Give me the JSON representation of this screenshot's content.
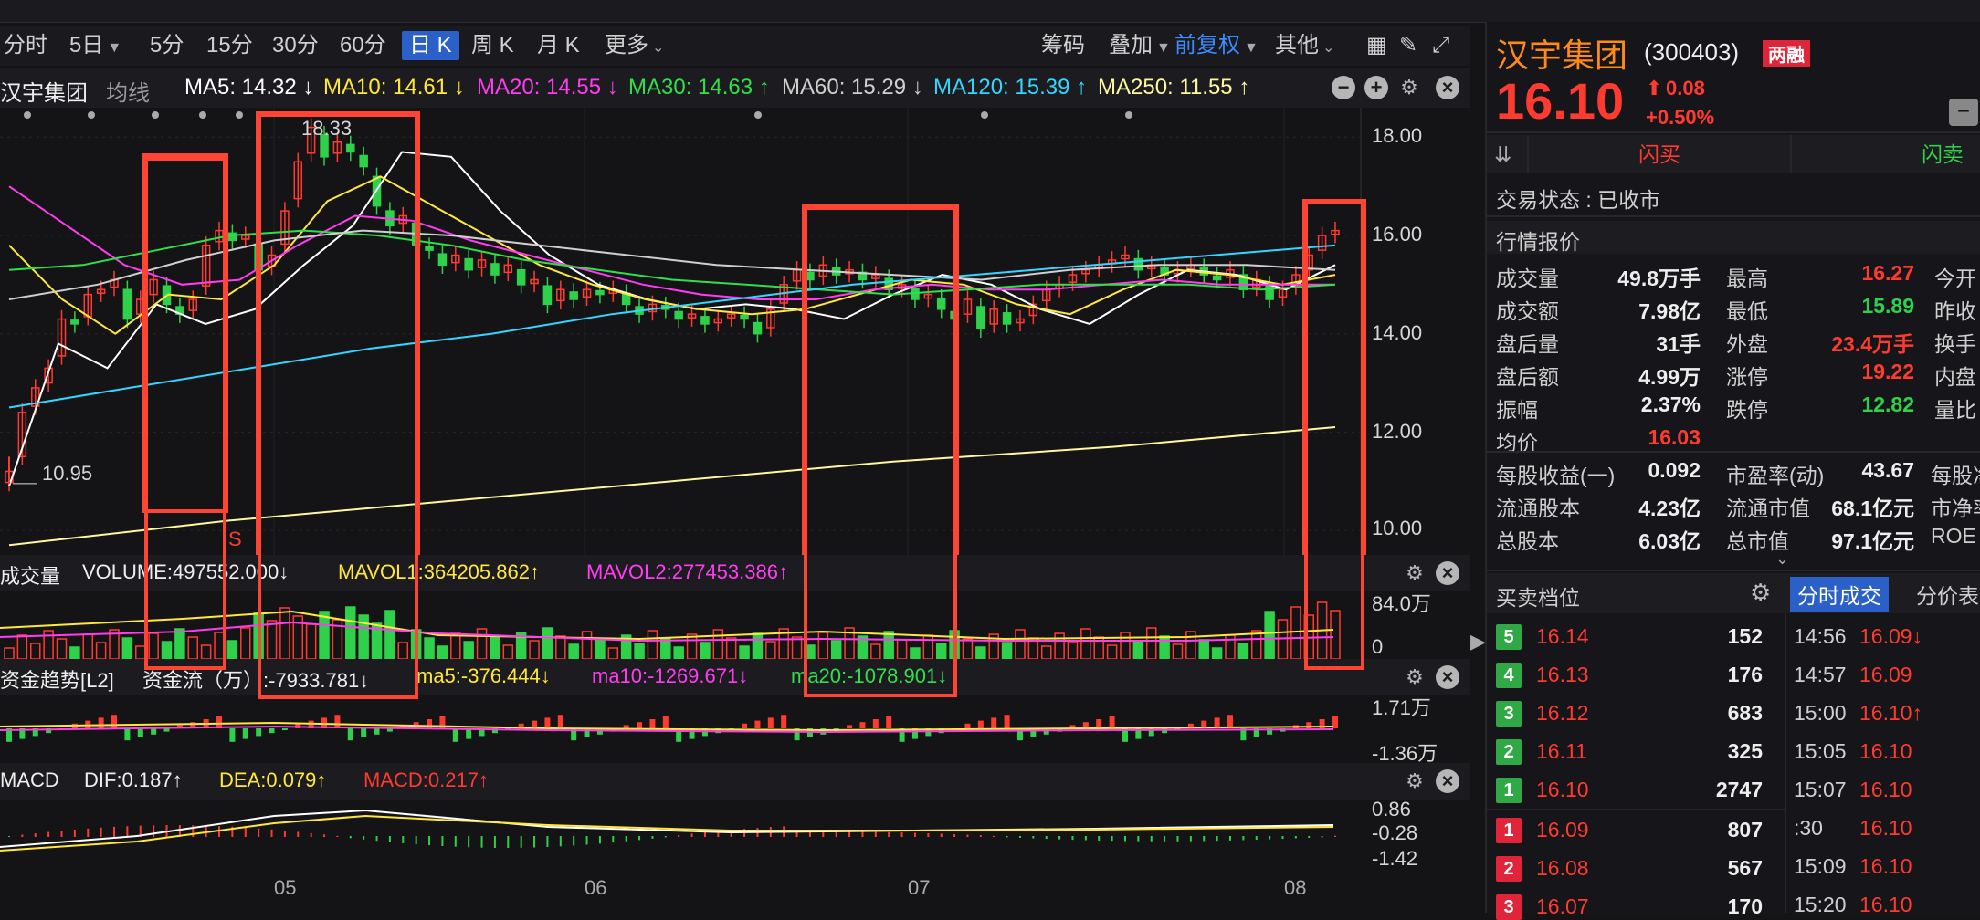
{
  "toolbar": {
    "periods": [
      "分时",
      "5日",
      "5分",
      "15分",
      "30分",
      "60分",
      "日 K",
      "周 K",
      "月 K",
      "更多"
    ],
    "active": "日 K",
    "right_items": [
      "筹码",
      "叠加",
      "前复权",
      "其他"
    ]
  },
  "stock": {
    "name": "汉宇集团",
    "code": "(300403)",
    "tag": "两融",
    "price": "16.10",
    "change": "0.08",
    "change_pct": "+0.50%"
  },
  "ma_line": {
    "mode": "均线",
    "items": [
      {
        "text": "MA5: 14.32 ↓",
        "color": "#ffffff"
      },
      {
        "text": "MA10: 14.61 ↓",
        "color": "#ffe83a"
      },
      {
        "text": "MA20: 14.55 ↓",
        "color": "#ff3cf0"
      },
      {
        "text": "MA30: 14.63 ↑",
        "color": "#2fe04a"
      },
      {
        "text": "MA60: 15.29 ↓",
        "color": "#cfcfcf"
      },
      {
        "text": "MA120: 15.39 ↑",
        "color": "#33d6ff"
      },
      {
        "text": "MA250: 11.55 ↑",
        "color": "#fff6a0"
      }
    ]
  },
  "price_axis": [
    "18.00",
    "16.00",
    "14.00",
    "12.00",
    "10.00"
  ],
  "annotations": {
    "high": "18.33",
    "low": "10.95",
    "marker": "S"
  },
  "volume": {
    "title": "成交量",
    "vol": "VOLUME:497552.000↓",
    "mavol1": "MAVOL1:364205.862↑",
    "mavol2": "MAVOL2:277453.386↑",
    "axis": [
      "84.0万",
      "0"
    ]
  },
  "fund": {
    "title": "资金趋势[L2]",
    "flow": "资金流（万）:-7933.781↓",
    "ma5": "ma5:-376.444↓",
    "ma10": "ma10:-1269.671↓",
    "ma20": "ma20:-1078.901↓",
    "axis": [
      "1.71万",
      "-1.36万"
    ]
  },
  "macd": {
    "title": "MACD",
    "dif": "DIF:0.187↑",
    "dea": "DEA:0.079↑",
    "macd": "MACD:0.217↑",
    "axis": [
      "0.86",
      "-0.28",
      "-1.42"
    ]
  },
  "months": [
    "05",
    "06",
    "07",
    "08"
  ],
  "right_panel": {
    "buy": "闪买",
    "sell": "闪卖",
    "status": "交易状态 : 已收市",
    "quote_title": "行情报价",
    "quotes": [
      [
        "成交量",
        "49.8万手",
        "最高",
        "16.27",
        "今开"
      ],
      [
        "成交额",
        "7.98亿",
        "最低",
        "15.89",
        "昨收"
      ],
      [
        "盘后量",
        "31手",
        "外盘",
        "23.4万手",
        "换手"
      ],
      [
        "盘后额",
        "4.99万",
        "涨停",
        "19.22",
        "内盘"
      ],
      [
        "振幅",
        "2.37%",
        "跌停",
        "12.82",
        "量比"
      ],
      [
        "均价",
        "16.03",
        "",
        "",
        ""
      ]
    ],
    "fundamentals": [
      [
        "每股收益(一)",
        "0.092",
        "市盈率(动)",
        "43.67",
        "每股净资"
      ],
      [
        "流通股本",
        "4.23亿",
        "流通市值",
        "68.1亿元",
        "市净率"
      ],
      [
        "总股本",
        "6.03亿",
        "总市值",
        "97.1亿元",
        "ROE"
      ]
    ],
    "orderbook_title": "买卖档位",
    "tab_active": "分时成交",
    "tab_other": "分价表",
    "asks": [
      {
        "lvl": "5",
        "price": "16.14",
        "vol": "152"
      },
      {
        "lvl": "4",
        "price": "16.13",
        "vol": "176"
      },
      {
        "lvl": "3",
        "price": "16.12",
        "vol": "683"
      },
      {
        "lvl": "2",
        "price": "16.11",
        "vol": "325"
      },
      {
        "lvl": "1",
        "price": "16.10",
        "vol": "2747"
      }
    ],
    "bids": [
      {
        "lvl": "1",
        "price": "16.09",
        "vol": "807"
      },
      {
        "lvl": "2",
        "price": "16.08",
        "vol": "567"
      },
      {
        "lvl": "3",
        "price": "16.07",
        "vol": "170"
      }
    ],
    "ticks": [
      {
        "time": "14:56",
        "price": "16.09↓"
      },
      {
        "time": "14:57",
        "price": "16.09"
      },
      {
        "time": "15:00",
        "price": "16.10↑"
      },
      {
        "time": "15:05",
        "price": "16.10"
      },
      {
        "time": "15:07",
        "price": "16.10"
      },
      {
        "time": ":30",
        "price": "16.10"
      },
      {
        "time": "15:09",
        "price": "16.10"
      },
      {
        "time": "15:20",
        "price": "16.10"
      }
    ]
  },
  "colors": {
    "up": "#ff3b30",
    "down": "#2fd14a",
    "highlight": "#ff4433",
    "accent": "#2b60c8"
  },
  "chart_data": {
    "type": "candlestick",
    "title": "",
    "ylim": [
      9.5,
      18.6
    ],
    "y_ticks": [
      10,
      12,
      14,
      16,
      18
    ],
    "x_ticks": [
      "05",
      "06",
      "07",
      "08"
    ],
    "closes": [
      11.2,
      12.4,
      12.9,
      13.3,
      14.3,
      14.2,
      14.8,
      14.9,
      15.1,
      14.3,
      14.7,
      15.1,
      14.6,
      14.4,
      14.7,
      15.8,
      16.1,
      15.9,
      16.0,
      15.3,
      15.6,
      16.5,
      17.5,
      18.2,
      17.6,
      17.9,
      17.7,
      17.4,
      16.6,
      16.2,
      16.4,
      15.8,
      15.7,
      15.4,
      15.6,
      15.3,
      15.5,
      15.2,
      15.4,
      15.0,
      15.1,
      14.6,
      14.9,
      14.7,
      14.9,
      14.8,
      14.9,
      14.6,
      14.4,
      14.6,
      14.5,
      14.3,
      14.4,
      14.2,
      14.3,
      14.4,
      14.3,
      14.0,
      14.5,
      15.0,
      15.3,
      15.1,
      15.4,
      15.2,
      15.3,
      15.1,
      15.2,
      14.9,
      15.0,
      14.7,
      14.8,
      14.5,
      14.3,
      14.7,
      14.1,
      14.5,
      14.2,
      14.3,
      14.6,
      14.9,
      15.0,
      15.2,
      15.3,
      15.4,
      15.5,
      15.6,
      15.3,
      15.4,
      15.2,
      15.3,
      15.4,
      15.2,
      15.1,
      15.3,
      14.9,
      15.1,
      14.7,
      14.9,
      15.2,
      15.6,
      16.0,
      16.1
    ],
    "series": [
      {
        "name": "MA5",
        "color": "#ffffff",
        "values": [
          10.9,
          13.8,
          13.3,
          14.6,
          14.2,
          14.5,
          15.4,
          16.2,
          17.7,
          17.6,
          16.5,
          15.6,
          15.0,
          14.7,
          14.5,
          14.6,
          14.5,
          14.3,
          14.8,
          15.2,
          15.0,
          14.5,
          14.2,
          14.8,
          15.3,
          15.2,
          14.9,
          15.4
        ]
      },
      {
        "name": "MA10",
        "color": "#ffe83a",
        "values": [
          15.8,
          14.7,
          14.0,
          14.8,
          14.7,
          15.4,
          16.7,
          17.2,
          16.6,
          16.0,
          15.4,
          15.0,
          14.7,
          14.5,
          14.4,
          14.5,
          14.8,
          15.1,
          15.0,
          14.6,
          14.4,
          14.9,
          15.3,
          15.2,
          15.0,
          15.2
        ]
      },
      {
        "name": "MA20",
        "color": "#ff3cf0",
        "values": [
          17.0,
          16.2,
          15.4,
          15.0,
          15.1,
          15.8,
          16.4,
          16.3,
          15.9,
          15.6,
          15.3,
          15.0,
          14.8,
          14.7,
          14.7,
          14.9,
          15.0,
          14.9,
          14.9,
          15.0,
          15.1,
          15.0,
          15.0,
          15.0
        ]
      },
      {
        "name": "MA30",
        "color": "#2fe04a",
        "values": [
          15.3,
          15.4,
          15.7,
          16.0,
          16.1,
          16.0,
          15.8,
          15.5,
          15.3,
          15.1,
          15.0,
          14.9,
          14.8,
          14.9,
          15.0,
          15.0,
          15.0,
          14.9,
          15.0
        ]
      },
      {
        "name": "MA60",
        "color": "#cfcfcf",
        "values": [
          14.7,
          15.0,
          15.5,
          15.9,
          16.1,
          16.0,
          15.8,
          15.6,
          15.4,
          15.3,
          15.2,
          15.1,
          15.3,
          15.4,
          15.4,
          15.3
        ]
      },
      {
        "name": "MA120",
        "color": "#33d6ff",
        "values": [
          12.5,
          12.9,
          13.3,
          13.7,
          14.0,
          14.4,
          14.7,
          15.0,
          15.2,
          15.4,
          15.6,
          15.8
        ]
      },
      {
        "name": "MA250",
        "color": "#fff6a0",
        "values": [
          9.7,
          10.2,
          10.6,
          11.0,
          11.4,
          11.7,
          12.1
        ]
      }
    ]
  }
}
